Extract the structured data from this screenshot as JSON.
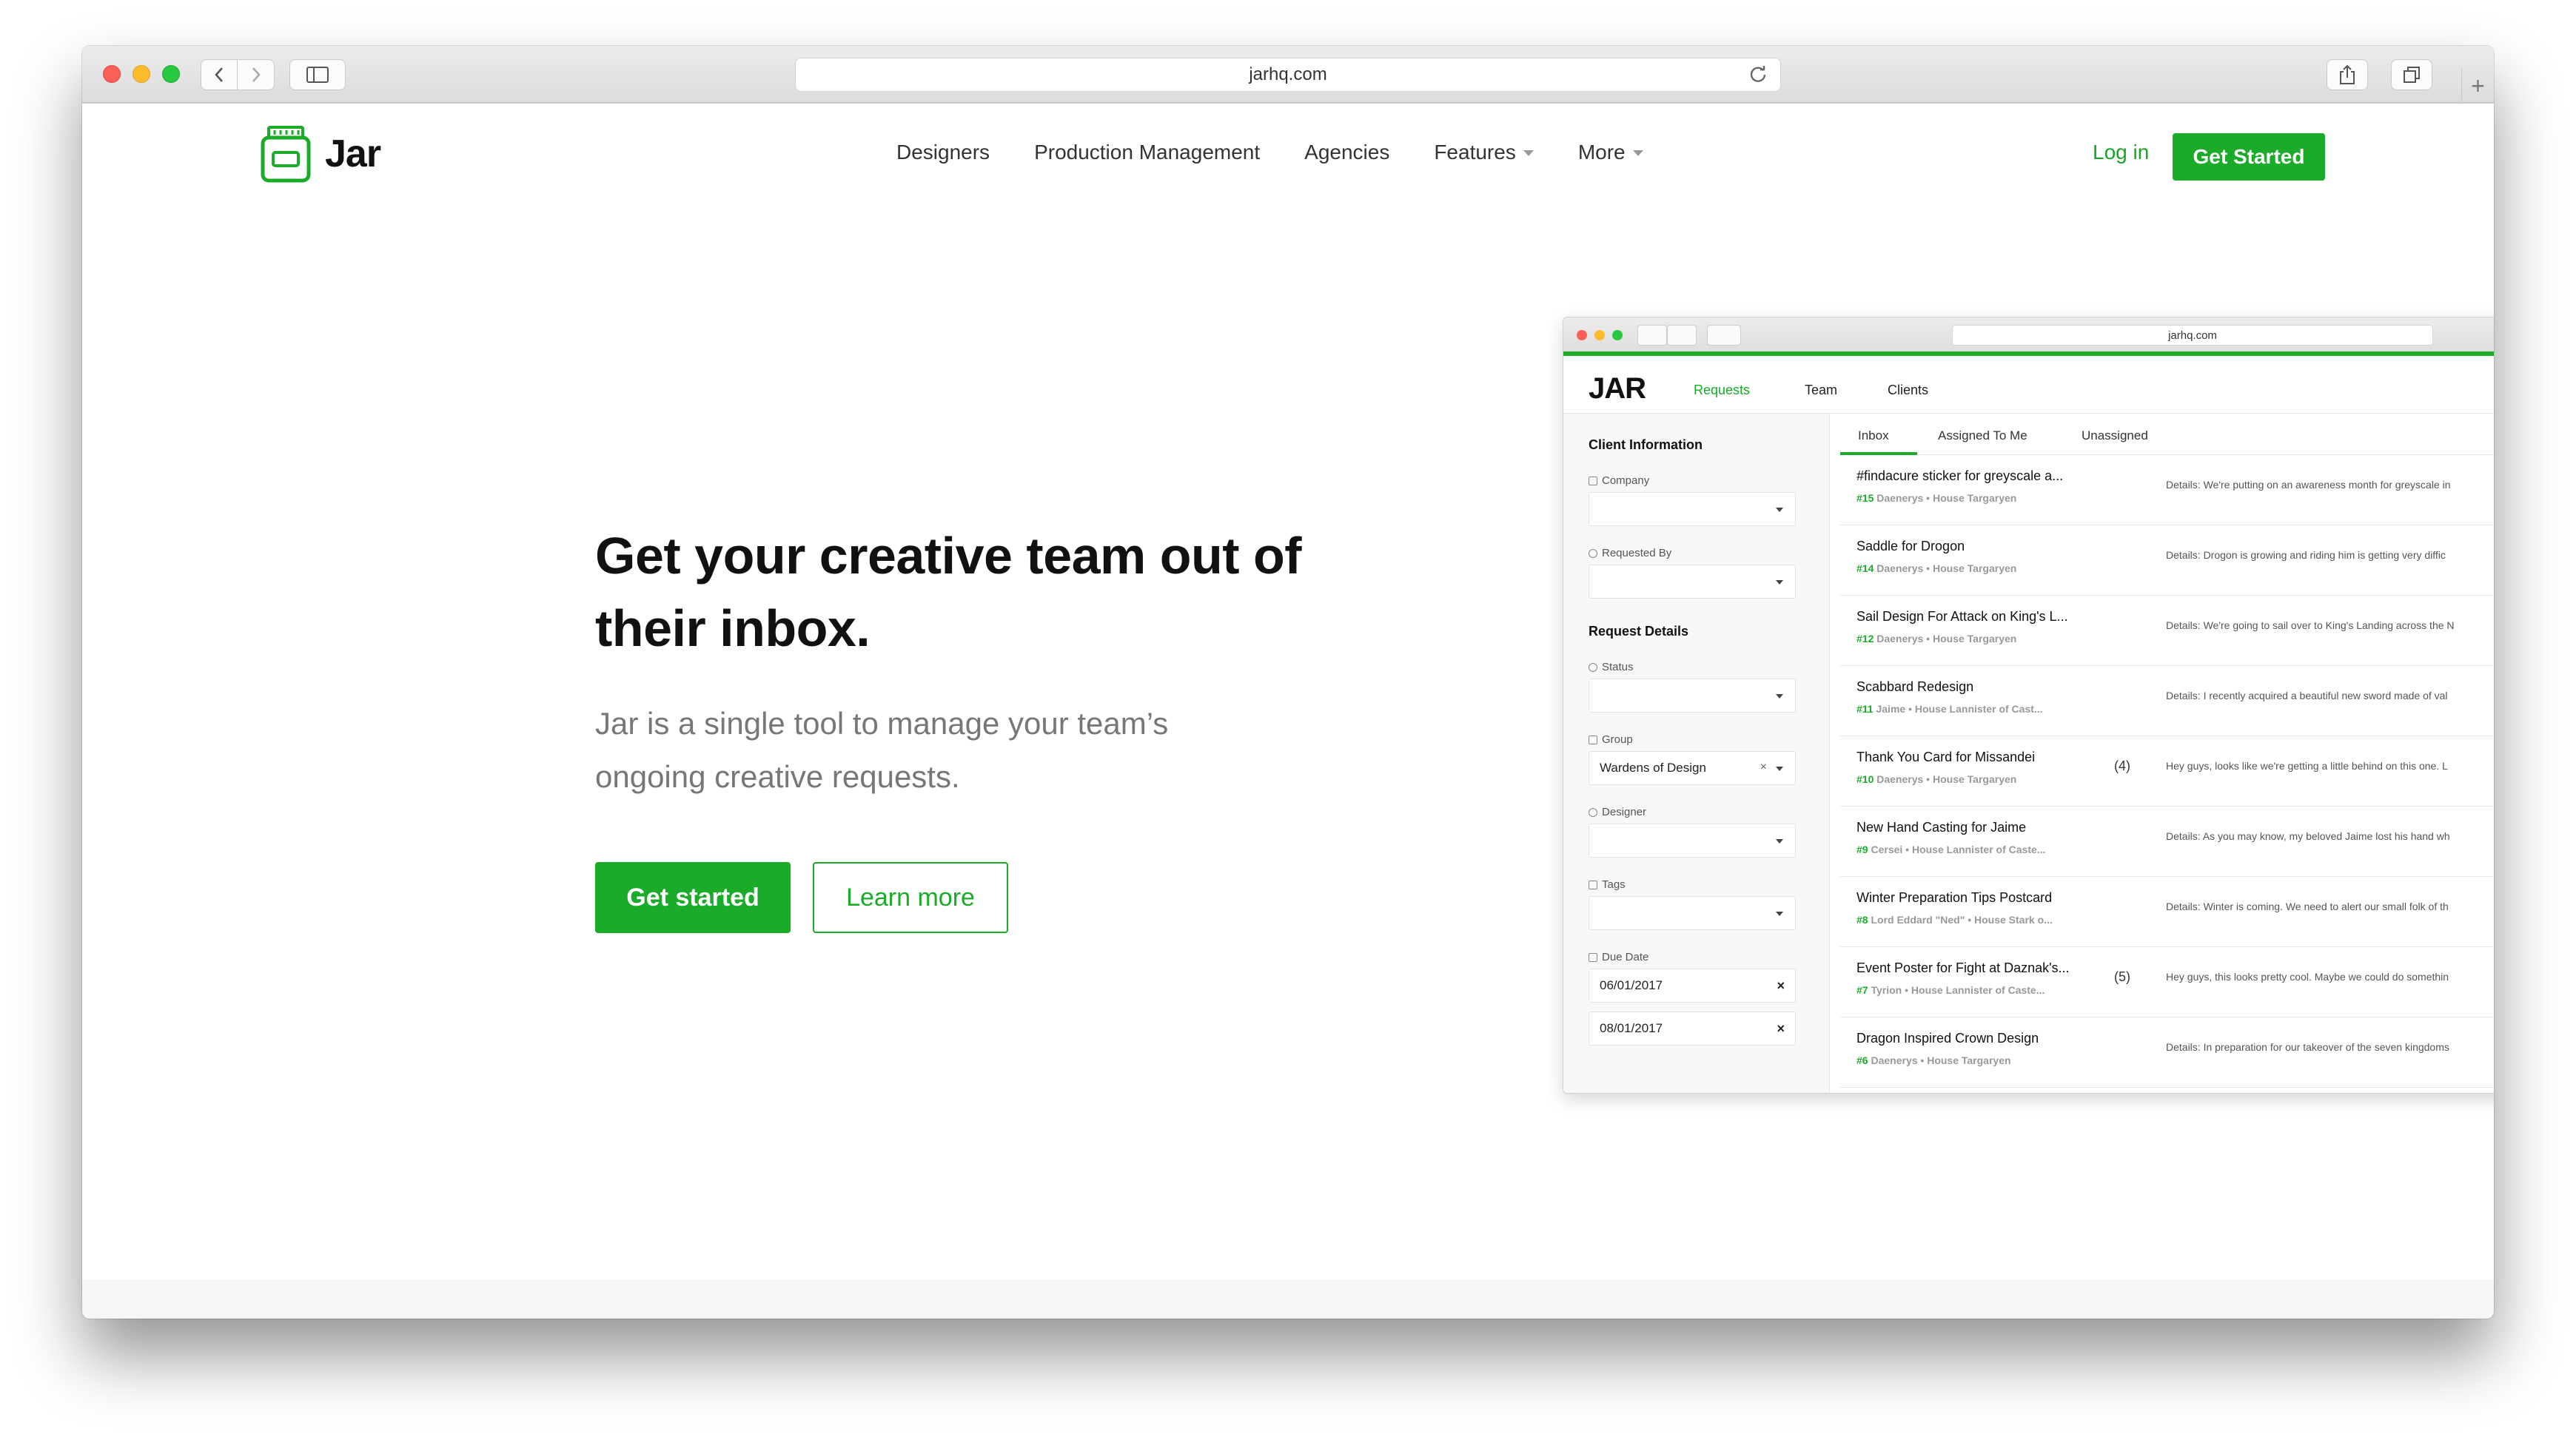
{
  "browser": {
    "url": "jarhq.com"
  },
  "site": {
    "logo_text": "Jar",
    "nav": [
      {
        "label": "Designers"
      },
      {
        "label": "Production Management"
      },
      {
        "label": "Agencies"
      },
      {
        "label": "Features"
      },
      {
        "label": "More"
      }
    ],
    "login_label": "Log in",
    "cta_label": "Get Started"
  },
  "hero": {
    "title": "Get your creative team out of their inbox.",
    "subtitle": "Jar is a single tool to manage your team’s ongoing creative requests.",
    "primary_button": "Get started",
    "secondary_button": "Learn more"
  },
  "colors": {
    "brand_green": "#1aab29"
  },
  "inner_app": {
    "url": "jarhq.com",
    "logo": "JAR",
    "nav": [
      "Requests",
      "Team",
      "Clients"
    ],
    "active_nav": "Requests",
    "sidebar": {
      "client_section": "Client Information",
      "company_label": "Company",
      "requested_by_label": "Requested By",
      "request_section": "Request Details",
      "status_label": "Status",
      "group_label": "Group",
      "group_value": "Wardens of Design",
      "designer_label": "Designer",
      "tags_label": "Tags",
      "due_date_label": "Due Date",
      "due_start": "06/01/2017",
      "due_end": "08/01/2017"
    },
    "tabs": [
      "Inbox",
      "Assigned To Me",
      "Unassigned"
    ],
    "active_tab": "Inbox",
    "requests": [
      {
        "title": "#findacure sticker for greyscale a...",
        "num": "#15",
        "person": "Daenerys",
        "house": "House Targaryen",
        "count": "",
        "details": "Details: We're putting on an awareness month for greyscale in"
      },
      {
        "title": "Saddle for Drogon",
        "num": "#14",
        "person": "Daenerys",
        "house": "House Targaryen",
        "count": "",
        "details": "Details: Drogon is growing and riding him is getting very diffic"
      },
      {
        "title": "Sail Design For Attack on King's L...",
        "num": "#12",
        "person": "Daenerys",
        "house": "House Targaryen",
        "count": "",
        "details": "Details: We're going to sail over to King's Landing across the N"
      },
      {
        "title": "Scabbard Redesign",
        "num": "#11",
        "person": "Jaime",
        "house": "House Lannister of Cast...",
        "count": "",
        "details": "Details: I recently acquired a beautiful new sword made of val"
      },
      {
        "title": "Thank You Card for Missandei",
        "num": "#10",
        "person": "Daenerys",
        "house": "House Targaryen",
        "count": "(4)",
        "details": "Hey guys, looks like we're getting a little behind on this one. L"
      },
      {
        "title": "New Hand Casting for Jaime",
        "num": "#9",
        "person": "Cersei",
        "house": "House Lannister of Caste...",
        "count": "",
        "details": "Details: As you may know, my beloved Jaime lost his hand wh"
      },
      {
        "title": "Winter Preparation Tips Postcard",
        "num": "#8",
        "person": "Lord Eddard \"Ned\"",
        "house": "House Stark o...",
        "count": "",
        "details": "Details: Winter is coming. We need to alert our small folk of th"
      },
      {
        "title": "Event Poster for Fight at Daznak's...",
        "num": "#7",
        "person": "Tyrion",
        "house": "House Lannister of Caste...",
        "count": "(5)",
        "details": "Hey guys, this looks pretty cool. Maybe we could do somethin"
      },
      {
        "title": "Dragon Inspired Crown Design",
        "num": "#6",
        "person": "Daenerys",
        "house": "House Targaryen",
        "count": "",
        "details": "Details: In preparation for our takeover of the seven kingdoms"
      }
    ]
  }
}
